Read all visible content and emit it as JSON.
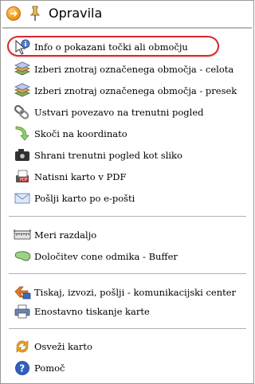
{
  "header": {
    "title": "Opravila",
    "colors": {
      "accent_orange": "#f29a13",
      "highlight_red": "#d7282f",
      "separator": "#b0b0b0"
    }
  },
  "sections": [
    {
      "items": [
        {
          "label": "Info o pokazani točki ali območju",
          "icon": "info-cursor-icon",
          "highlighted": true
        },
        {
          "label": "Izberi znotraj označenega območja - celota",
          "icon": "layers-select-icon"
        },
        {
          "label": "Izberi znotraj označenega območja - presek",
          "icon": "layers-intersect-icon"
        },
        {
          "label": "Ustvari povezavo na trenutni pogled",
          "icon": "chain-link-icon"
        },
        {
          "label": "Skoči na koordinato",
          "icon": "jump-arrow-icon"
        },
        {
          "label": "Shrani trenutni pogled kot sliko",
          "icon": "camera-icon"
        },
        {
          "label": "Natisni karto v PDF",
          "icon": "pdf-printer-icon"
        },
        {
          "label": "Pošlji karto po e-pošti",
          "icon": "envelope-icon"
        }
      ]
    },
    {
      "items": [
        {
          "label": "Meri razdaljo",
          "icon": "ruler-icon"
        },
        {
          "label": "Določitev cone odmika - Buffer",
          "icon": "buffer-zone-icon"
        }
      ]
    },
    {
      "items": [
        {
          "label": "Tiskaj, izvozi, pošlji - komunikacijski center",
          "icon": "print-export-icon"
        },
        {
          "label": "Enostavno tiskanje karte",
          "icon": "printer-icon"
        }
      ]
    },
    {
      "items": [
        {
          "label": "Osveži karto",
          "icon": "refresh-icon"
        },
        {
          "label": "Pomoč",
          "icon": "help-icon"
        }
      ]
    }
  ]
}
